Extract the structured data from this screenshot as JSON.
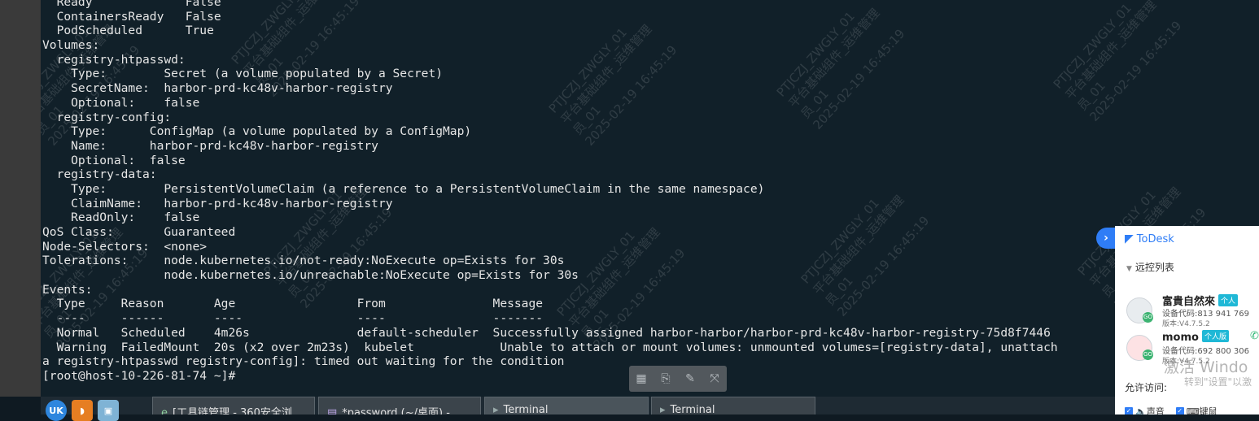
{
  "terminal": {
    "lines": [
      "  Ready             False",
      "  ContainersReady   False",
      "  PodScheduled      True",
      "Volumes:",
      "  registry-htpasswd:",
      "    Type:        Secret (a volume populated by a Secret)",
      "    SecretName:  harbor-prd-kc48v-harbor-registry",
      "    Optional:    false",
      "  registry-config:",
      "    Type:      ConfigMap (a volume populated by a ConfigMap)",
      "    Name:      harbor-prd-kc48v-harbor-registry",
      "    Optional:  false",
      "  registry-data:",
      "    Type:        PersistentVolumeClaim (a reference to a PersistentVolumeClaim in the same namespace)",
      "    ClaimName:   harbor-prd-kc48v-harbor-registry",
      "    ReadOnly:    false",
      "QoS Class:       Guaranteed",
      "Node-Selectors:  <none>",
      "Tolerations:     node.kubernetes.io/not-ready:NoExecute op=Exists for 30s",
      "                 node.kubernetes.io/unreachable:NoExecute op=Exists for 30s",
      "Events:",
      "  Type     Reason       Age                 From               Message",
      "  ----     ------       ----                ----               -------",
      "  Normal   Scheduled    4m26s               default-scheduler  Successfully assigned harbor-harbor/harbor-prd-kc48v-harbor-registry-75d8f7446",
      "  Warning  FailedMount  20s (x2 over 2m23s)  kubelet            Unable to attach or mount volumes: unmounted volumes=[registry-data], unattach",
      "a registry-htpasswd registry-config]: timed out waiting for the condition",
      "[root@host-10-226-81-74 ~]#"
    ]
  },
  "watermarks": [
    "PTJCZJ_ZWGLY_01\n平台基础组件_运维管理\n员_01\n2025-02-19 16:45:19"
  ],
  "mini_toolbar": {
    "icons": [
      "grid-icon",
      "clipboard-icon",
      "pen-icon",
      "fullscreen-icon"
    ]
  },
  "taskbar": {
    "items": [
      {
        "label": "[工具链管理 - 360安全浏…",
        "icon": "browser-icon"
      },
      {
        "label": "*password (~/桌面) - …",
        "icon": "editor-icon"
      },
      {
        "label": "Terminal",
        "icon": "terminal-icon",
        "active": true
      },
      {
        "label": "Terminal",
        "icon": "terminal-icon",
        "active": false
      }
    ]
  },
  "todesk": {
    "title": "ToDesk",
    "section_label": "远控列表",
    "devices": [
      {
        "name": "富貴自然來",
        "badge": "个人",
        "code": "设备代码:813 941 769",
        "version": "版本:V4.7.5.2"
      },
      {
        "name": "momo",
        "badge": "个人版",
        "code": "设备代码:692 800 306",
        "version": "版本:V4.7.5.2"
      }
    ],
    "allow_label": "允许访问:",
    "checks": [
      "声音",
      "键鼠"
    ],
    "colors": {
      "brand": "#2f7df6",
      "online": "#3cb371",
      "badge": "#1fb8d6"
    }
  },
  "windows_activation": {
    "line1": "激活 Windo",
    "line2": "转到\"设置\"以激"
  }
}
